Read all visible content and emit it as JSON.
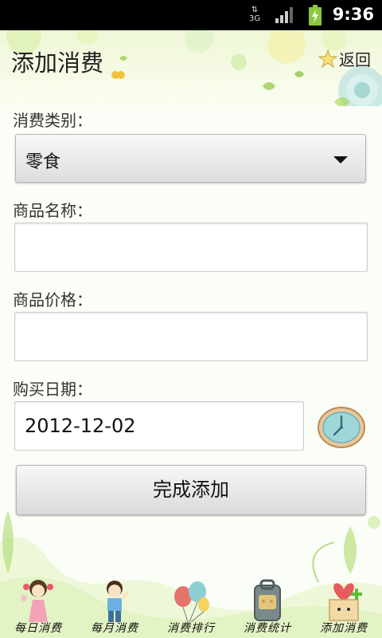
{
  "status_bar": {
    "network": "3G",
    "time": "9:36"
  },
  "header": {
    "title": "添加消费",
    "back_label": "返回"
  },
  "form": {
    "category_label": "消费类别：",
    "category_value": "零食",
    "name_label": "商品名称：",
    "name_value": "",
    "price_label": "商品价格：",
    "price_value": "",
    "date_label": "购买日期：",
    "date_value": "2012-12-02",
    "submit_label": "完成添加"
  },
  "tabs": [
    {
      "label": "每日消费",
      "icon": "girl-icon"
    },
    {
      "label": "每月消费",
      "icon": "boy-icon"
    },
    {
      "label": "消费排行",
      "icon": "balloons-icon"
    },
    {
      "label": "消费统计",
      "icon": "backpack-icon"
    },
    {
      "label": "添加消费",
      "icon": "gift-box-icon"
    }
  ],
  "colors": {
    "accent_green": "#8cc63f",
    "button_gray": "#dedede"
  }
}
